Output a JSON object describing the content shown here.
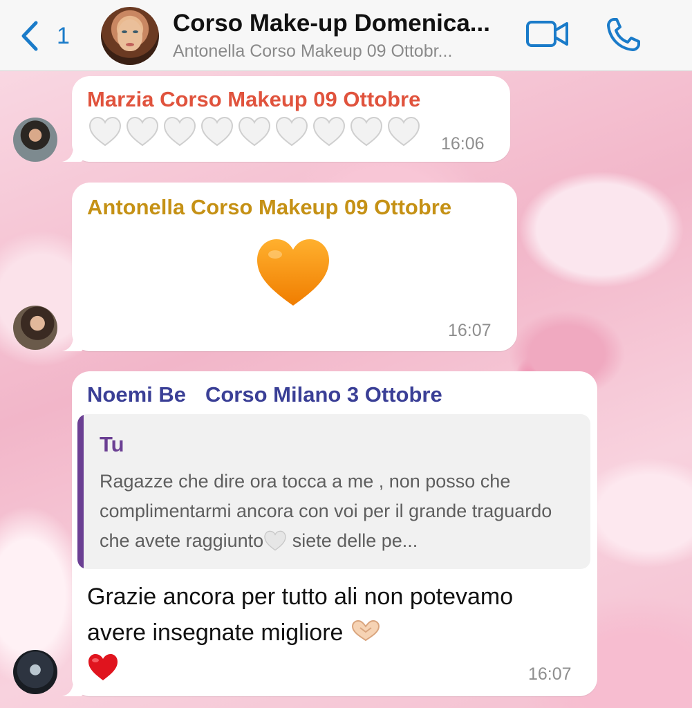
{
  "header": {
    "back_count": "1",
    "title": "Corso Make-up Domenica...",
    "subtitle": "Antonella Corso Makeup 09 Ottobr..."
  },
  "messages": [
    {
      "sender": "Marzia Corso Makeup 09 Ottobre",
      "sender_color": "#e0533d",
      "content": "white hearts x9",
      "time": "16:06"
    },
    {
      "sender": "Antonella Corso Makeup 09 Ottobre",
      "sender_color": "#c59115",
      "content": "orange heart",
      "time": "16:07"
    },
    {
      "sender_part1": "Noemi Be",
      "sender_part2": "Corso Milano 3 Ottobre",
      "sender_color": "#3a3f96",
      "quote_author": "Tu",
      "quote_text": "Ragazze che dire ora tocca a me , non posso che complimentarmi ancora con voi per il grande traguardo che avete raggiunto",
      "quote_text_end": " siete delle pe...",
      "text": "Grazie ancora per tutto ali non potevamo avere insegnate migliore",
      "time": "16:07"
    }
  ],
  "icons": {
    "back": "chevron-left-icon",
    "video": "video-camera-icon",
    "call": "phone-icon"
  },
  "colors": {
    "accent": "#1a7bc9",
    "quote_bar": "#6b3f93"
  }
}
